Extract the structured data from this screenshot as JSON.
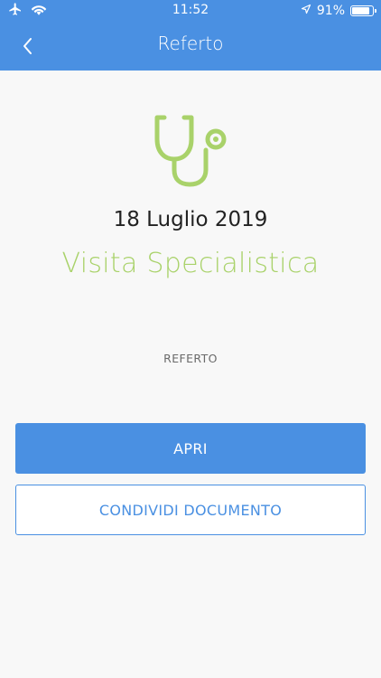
{
  "status_bar": {
    "time": "11:52",
    "battery_text": "91%",
    "battery_level": 0.91,
    "icons": [
      "airplane-icon",
      "wifi-icon",
      "location-arrow-icon",
      "battery-icon"
    ]
  },
  "nav": {
    "title": "Referto",
    "back_icon": "chevron-left-icon"
  },
  "content": {
    "icon": "stethoscope-icon",
    "date": "18 Luglio 2019",
    "visit_type": "Visita Specialistica",
    "document_label": "REFERTO"
  },
  "actions": {
    "open_label": "APRI",
    "share_label": "CONDIVIDI DOCUMENTO"
  },
  "colors": {
    "primary": "#4a90e2",
    "accent_green": "#a9d26a",
    "background": "#f8f8f8"
  }
}
